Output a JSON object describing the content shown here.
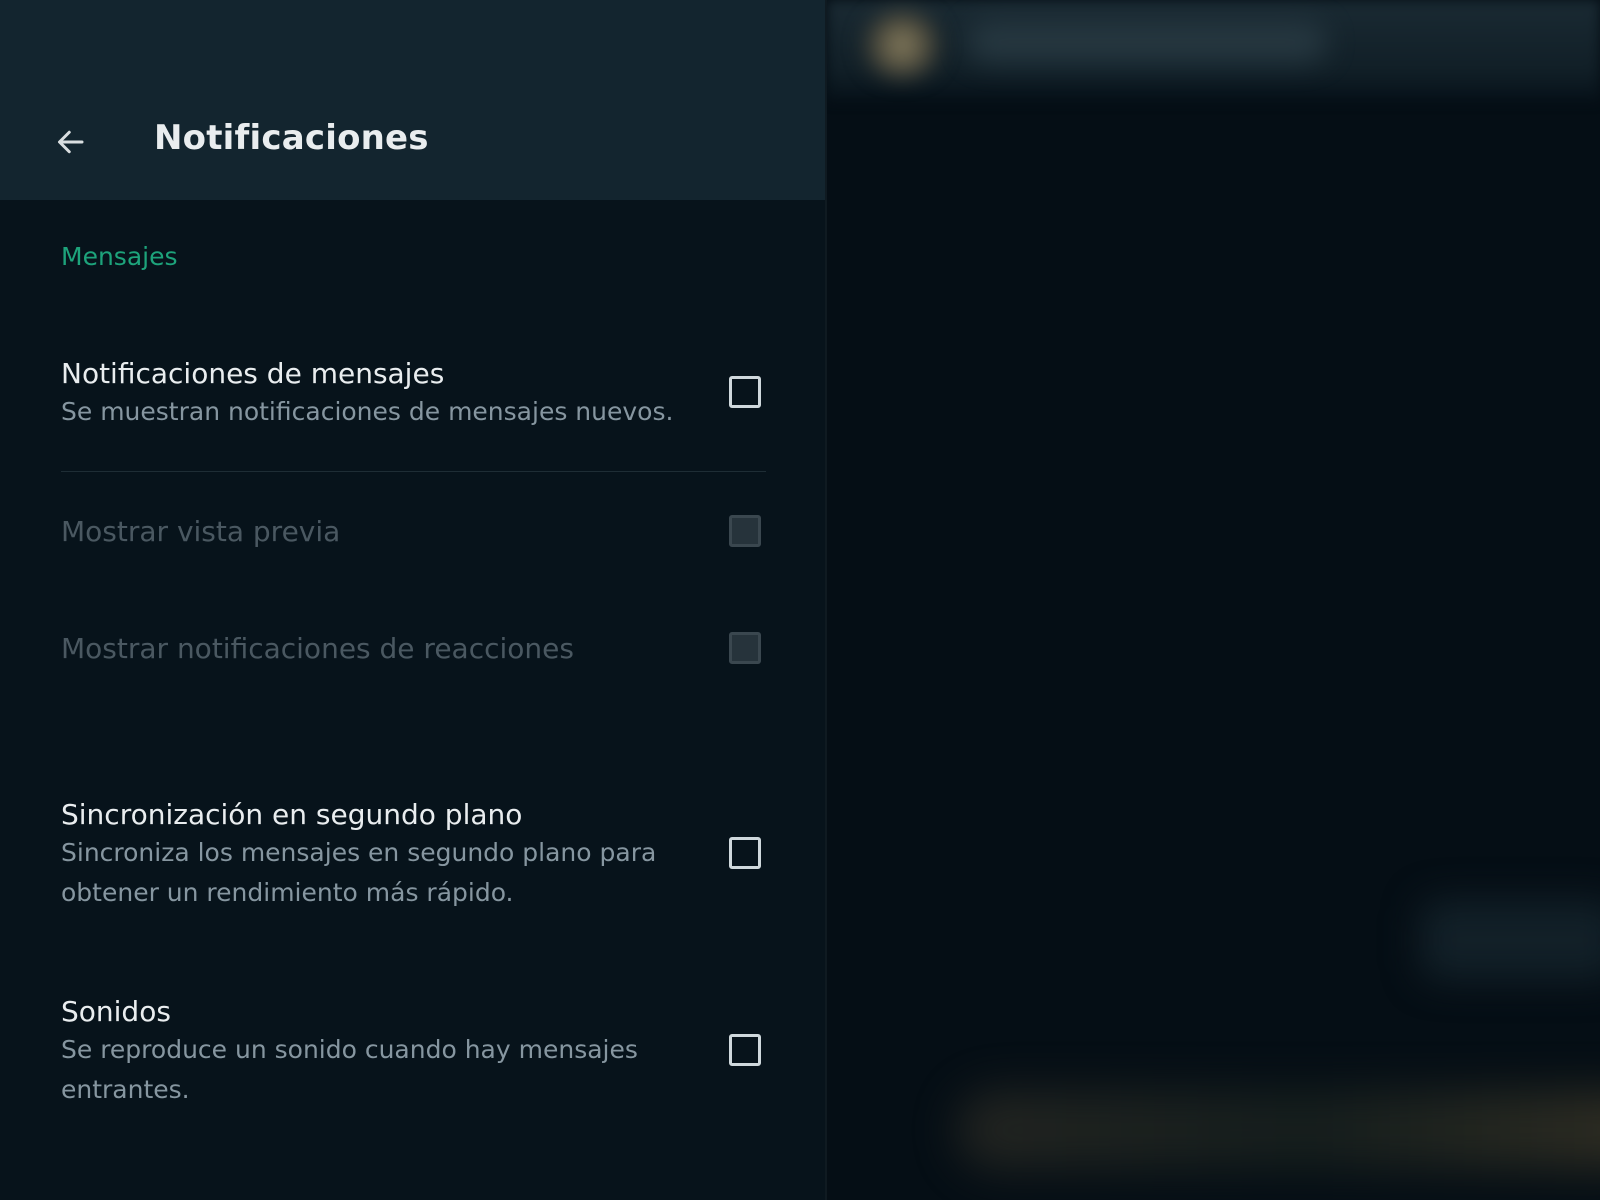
{
  "header": {
    "back_icon": "arrow-left-icon",
    "title": "Notificaciones"
  },
  "section": {
    "title": "Mensajes"
  },
  "settings": [
    {
      "title": "Notificaciones de mensajes",
      "description": "Se muestran notificaciones de mensajes nuevos.",
      "checked": false,
      "enabled": true
    },
    {
      "title": "Mostrar vista previa",
      "checked": false,
      "enabled": false
    },
    {
      "title": "Mostrar notificaciones de reacciones",
      "checked": false,
      "enabled": false
    },
    {
      "title": "Sincronización en segundo plano",
      "description": "Sincroniza los mensajes en segundo plano para obtener un rendimiento más rápido.",
      "checked": false,
      "enabled": true
    },
    {
      "title": "Sonidos",
      "description": "Se reproduce un sonido cuando hay mensajes entrantes.",
      "checked": false,
      "enabled": true
    }
  ],
  "colors": {
    "header_bg": "#13252f",
    "panel_bg": "#07131b",
    "accent": "#1da37b",
    "primary_text": "#e9edef",
    "secondary_text": "#8696a0",
    "disabled_text": "#4a5861"
  }
}
